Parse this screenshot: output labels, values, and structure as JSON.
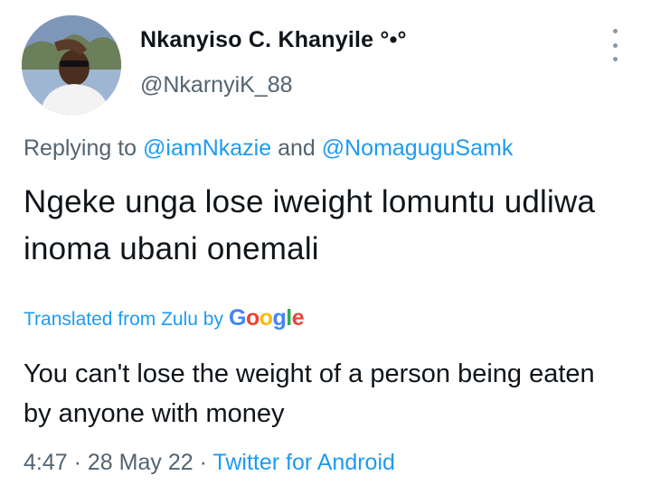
{
  "author": {
    "display_name": "Nkanyiso C. Khanyile °•°",
    "handle": "@NkarnyiK_88"
  },
  "reply": {
    "prefix": "Replying to",
    "mention1": "@iamNkazie",
    "conjunction": "and",
    "mention2": "@NomaguguSamk"
  },
  "tweet": {
    "text": "Ngeke unga lose iweight lomuntu udliwa inoma ubani onemali"
  },
  "translation": {
    "label": "Translated from Zulu by",
    "provider": "Google",
    "text": "You can't lose the weight of a person being eaten by anyone with money"
  },
  "meta": {
    "time": "4:47",
    "separator1": "·",
    "date": "28 May 22",
    "separator2": "·",
    "source": "Twitter for Android"
  },
  "colors": {
    "accent": "#1d9bf0",
    "secondary_text": "#536471",
    "primary_text": "#0f1419"
  },
  "icons": {
    "more": "more-vertical-icon",
    "avatar": "profile-photo"
  }
}
